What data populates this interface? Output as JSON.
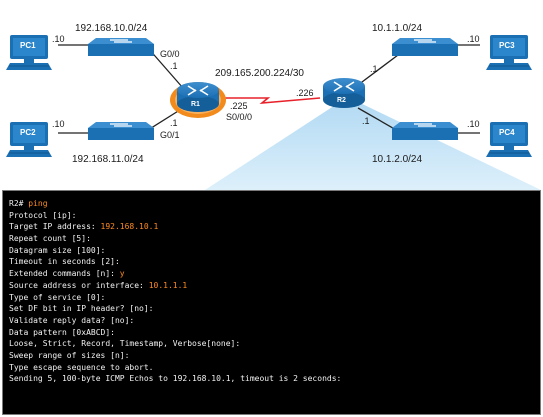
{
  "topology": {
    "networks": {
      "left_top": "192.168.10.0/24",
      "left_bottom": "192.168.11.0/24",
      "wan": "209.165.200.224/30",
      "right_top": "10.1.1.0/24",
      "right_bottom": "10.1.2.0/24"
    },
    "devices": {
      "pc1": "PC1",
      "pc2": "PC2",
      "pc3": "PC3",
      "pc4": "PC4",
      "r1": "R1",
      "r2": "R2"
    },
    "host_addresses": {
      "pc1": ".10",
      "pc2": ".10",
      "pc3": ".10",
      "pc4": ".10"
    },
    "interfaces": {
      "r1_g00_name": "G0/0",
      "r1_g00_addr": ".1",
      "r1_g01_name": "G0/1",
      "r1_g01_addr": ".1",
      "r1_s000_addr": ".225",
      "r1_s000_name": "S0/0/0",
      "r2_serial_addr": ".226",
      "r2_top_addr": ".1",
      "r2_bottom_addr": ".1"
    },
    "colors": {
      "device_blue": "#1b6fb3",
      "router_highlight": "#f28a1c",
      "serial_link": "#e8212a",
      "zoom_wedge": "#bfe0f5"
    }
  },
  "terminal": {
    "lines": [
      {
        "prefix": "R2# ",
        "value": "ping"
      },
      {
        "prefix": "Protocol [ip]:",
        "value": ""
      },
      {
        "prefix": "Target IP address: ",
        "value": "192.168.10.1"
      },
      {
        "prefix": "Repeat count [5]:",
        "value": ""
      },
      {
        "prefix": "Datagram size [100]:",
        "value": ""
      },
      {
        "prefix": "Timeout in seconds [2]:",
        "value": ""
      },
      {
        "prefix": "Extended commands [n]: ",
        "value": "y"
      },
      {
        "prefix": "Source address or interface: ",
        "value": "10.1.1.1"
      },
      {
        "prefix": "Type of service [0]:",
        "value": ""
      },
      {
        "prefix": "Set DF bit in IP header? [no]:",
        "value": ""
      },
      {
        "prefix": "Validate reply data? [no]:",
        "value": ""
      },
      {
        "prefix": "Data pattern [0xABCD]:",
        "value": ""
      },
      {
        "prefix": "Loose, Strict, Record, Timestamp, Verbose[none]:",
        "value": ""
      },
      {
        "prefix": "Sweep range of sizes [n]:",
        "value": ""
      },
      {
        "prefix": "Type escape sequence to abort.",
        "value": ""
      },
      {
        "prefix": "Sending 5, 100-byte ICMP Echos to 192.168.10.1, timeout is 2 seconds:",
        "value": ""
      }
    ]
  }
}
